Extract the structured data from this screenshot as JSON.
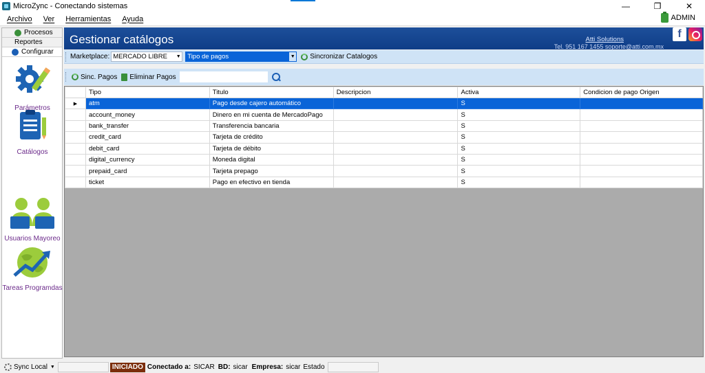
{
  "window": {
    "title": "MicroZync - Conectando sistemas",
    "minimize": "—",
    "restore": "❐",
    "close": "✕"
  },
  "menu": {
    "items": [
      "Archivo",
      "Ver",
      "Herramientas",
      "Ayuda"
    ],
    "user": "ADMIN"
  },
  "sidebar": {
    "tabs": [
      "Procesos",
      "Reportes",
      "Configurar"
    ],
    "items": [
      "Parámetros",
      "Catálogos",
      "Usuarios Mayoreo",
      "Tareas Programdas"
    ]
  },
  "header": {
    "title": "Gestionar catálogos",
    "company": "Atti Solutions",
    "contact": "Tel. 951 167 1455  soporte@atti.com.mx",
    "facebook_glyph": "f"
  },
  "toolbar": {
    "marketplace_label": "Marketplace:",
    "marketplace_value": "MERCADO LIBRE",
    "catalog_value": "Tipo de pagos",
    "sync_catalogs_label": "Sincronizar Catalogos",
    "sync_payments_label": "Sinc. Pagos",
    "delete_payments_label": "Eliminar Pagos",
    "search_value": ""
  },
  "grid": {
    "columns": [
      "Tipo",
      "Titulo",
      "Descripcion",
      "Activa",
      "Condicion de pago Origen"
    ],
    "selected_marker": "▶",
    "rows": [
      {
        "tipo": "atm",
        "titulo": "Pago desde cajero automático",
        "descripcion": "",
        "activa": "S",
        "condicion": ""
      },
      {
        "tipo": "account_money",
        "titulo": "Dinero en mi cuenta de MercadoPago",
        "descripcion": "",
        "activa": "S",
        "condicion": ""
      },
      {
        "tipo": "bank_transfer",
        "titulo": "Transferencia bancaria",
        "descripcion": "",
        "activa": "S",
        "condicion": ""
      },
      {
        "tipo": "credit_card",
        "titulo": "Tarjeta de crédito",
        "descripcion": "",
        "activa": "S",
        "condicion": ""
      },
      {
        "tipo": "debit_card",
        "titulo": "Tarjeta de débito",
        "descripcion": "",
        "activa": "S",
        "condicion": ""
      },
      {
        "tipo": "digital_currency",
        "titulo": "Moneda digital",
        "descripcion": "",
        "activa": "S",
        "condicion": ""
      },
      {
        "tipo": "prepaid_card",
        "titulo": "Tarjeta prepago",
        "descripcion": "",
        "activa": "S",
        "condicion": ""
      },
      {
        "tipo": "ticket",
        "titulo": "Pago en efectivo en tienda",
        "descripcion": "",
        "activa": "S",
        "condicion": ""
      }
    ]
  },
  "status": {
    "sync_label": "Sync Local",
    "state": "INICIADO",
    "connected_label": "Conectado a:",
    "connected_value": "SICAR",
    "db_label": "BD:",
    "db_value": "sicar",
    "company_label": "Empresa:",
    "company_value": "sicar",
    "estado_label": "Estado"
  },
  "colors": {
    "header_blue": "#0f3d87",
    "selection_blue": "#0a64d8",
    "toolbar_bg": "#cfe3f6",
    "sidebar_text": "#6b2a8a",
    "status_badge": "#7b2d0b"
  }
}
